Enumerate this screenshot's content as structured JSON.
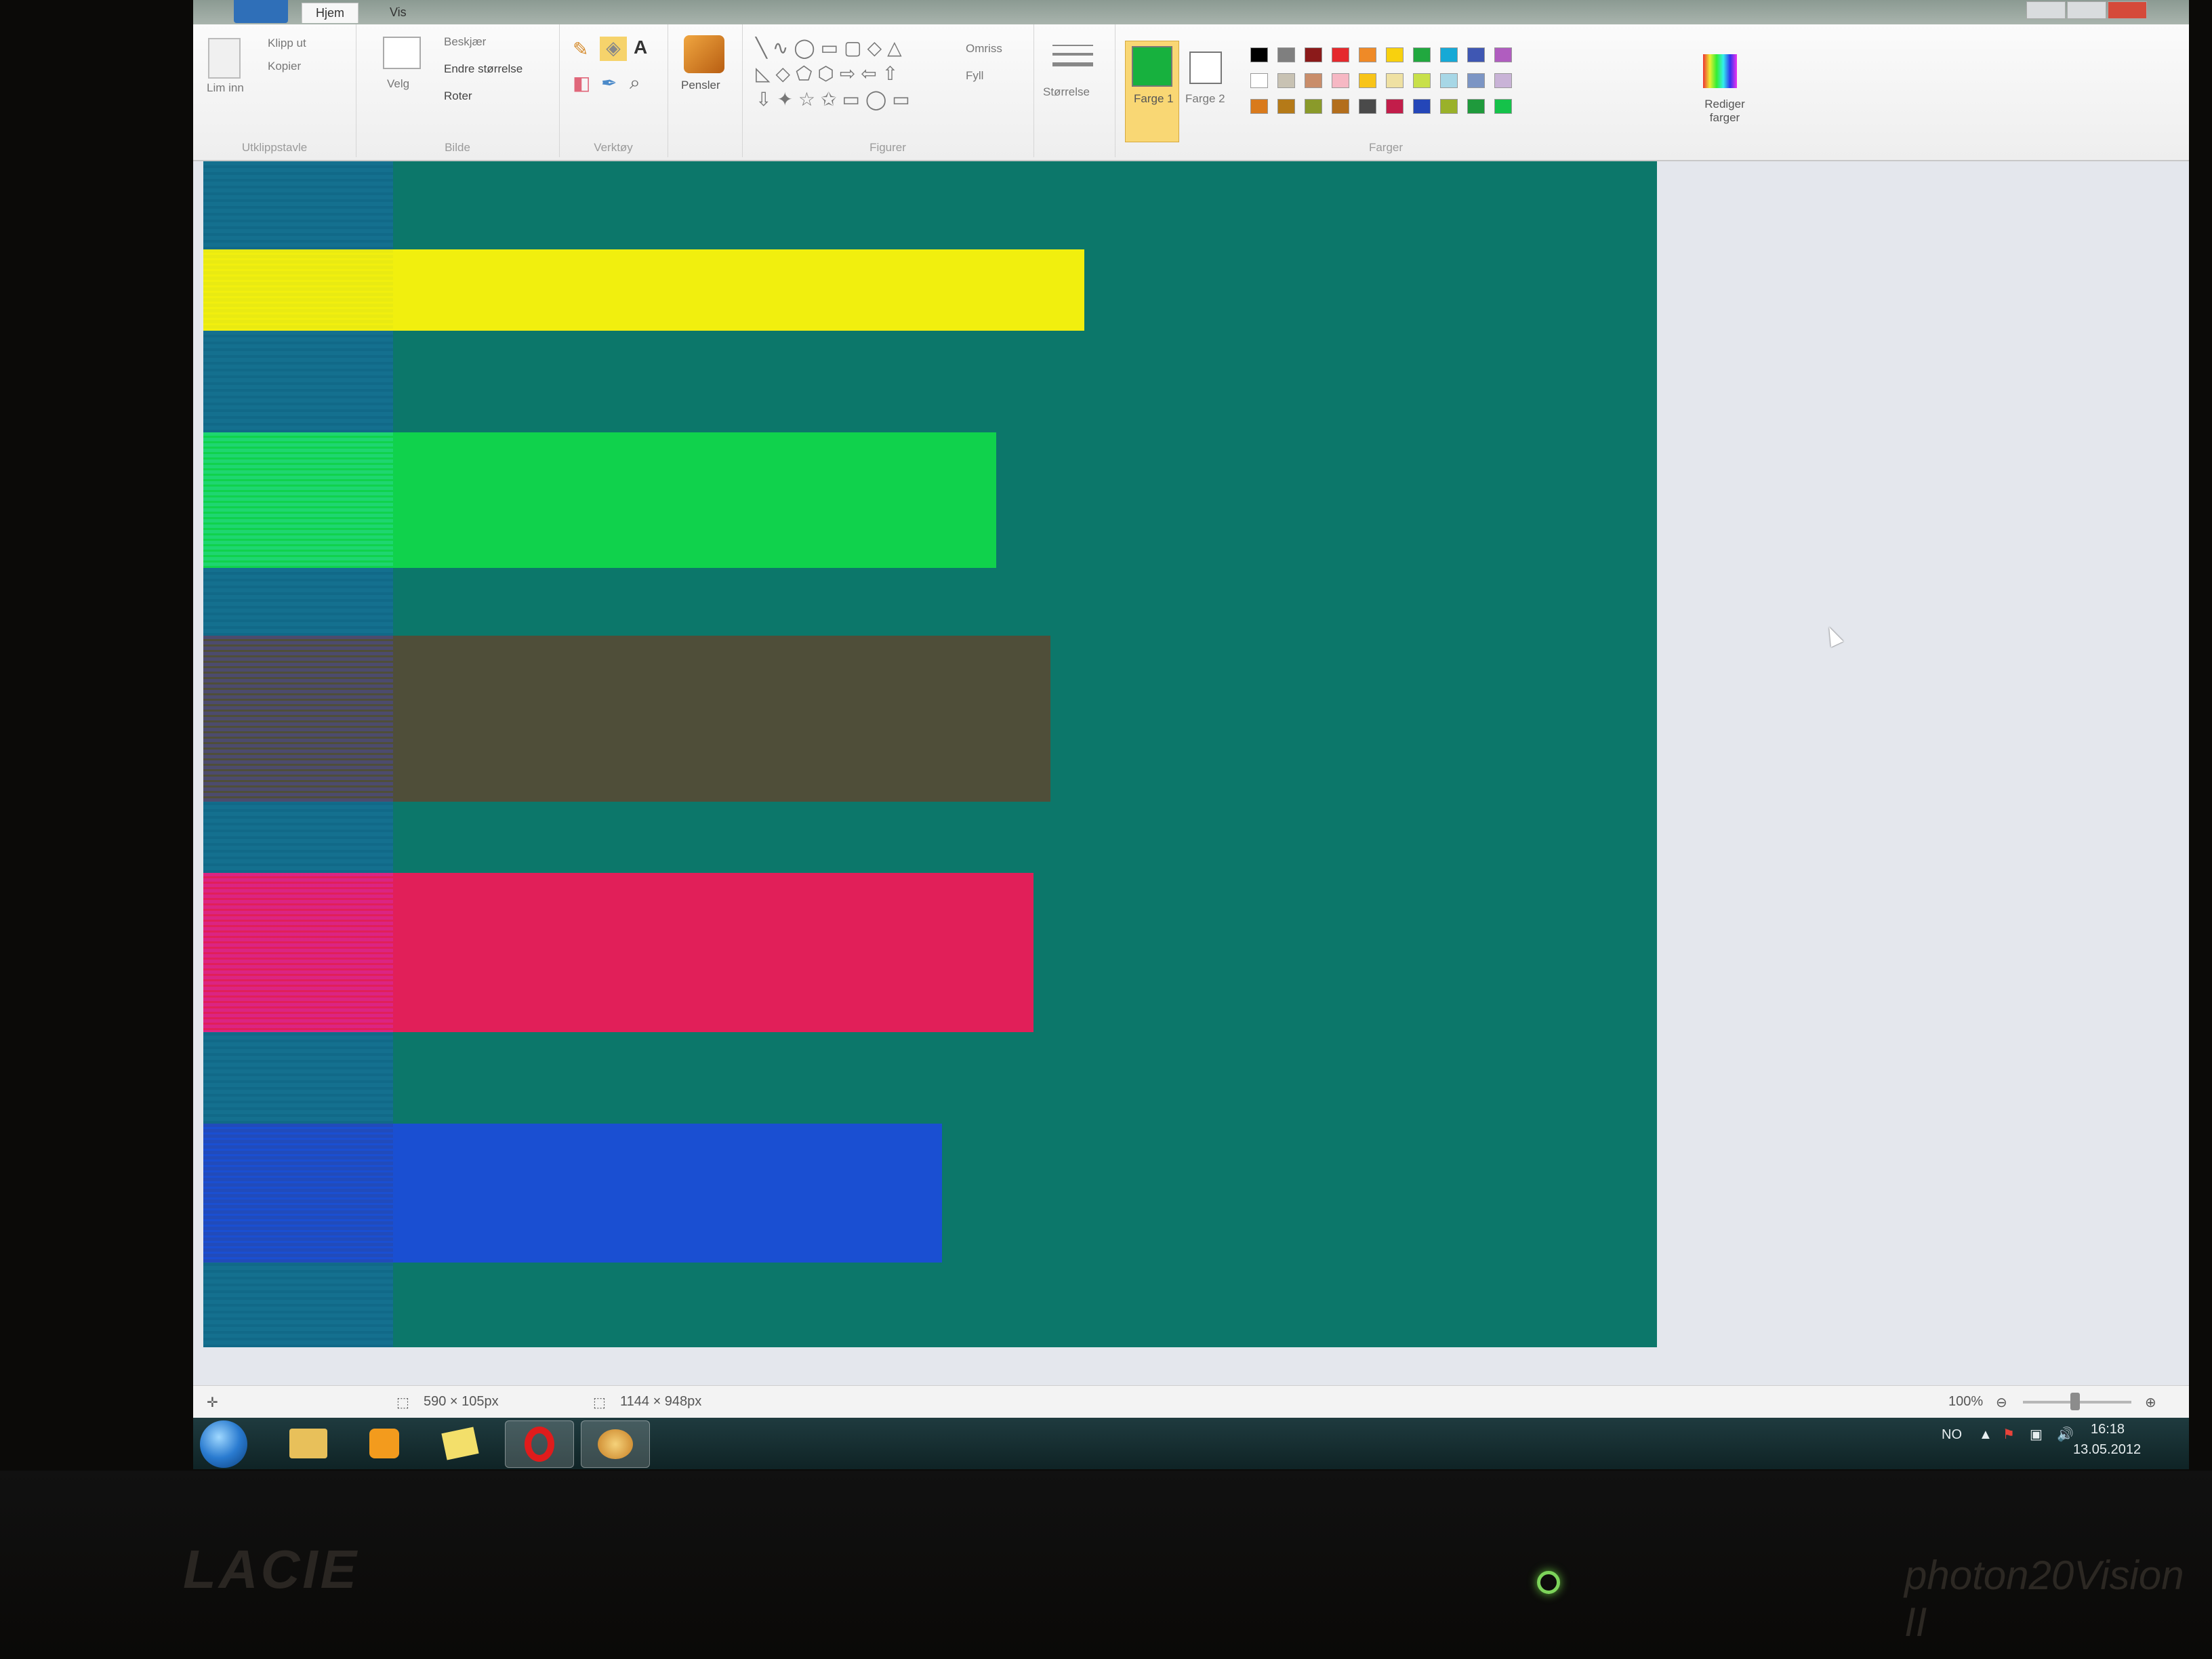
{
  "ribbon": {
    "tabs": [
      "Hjem",
      "Vis"
    ],
    "groups": {
      "clipboard": {
        "label": "Utklippstavle",
        "paste": "Lim inn",
        "cut": "Klipp ut",
        "copy": "Kopier"
      },
      "image": {
        "label": "Bilde",
        "select": "Velg",
        "crop": "Beskjær",
        "resize": "Endre størrelse",
        "rotate": "Roter"
      },
      "tools": {
        "label": "Verktøy"
      },
      "brushes": {
        "label": "Pensler"
      },
      "shapes": {
        "label": "Figurer",
        "outline": "Omriss",
        "fill": "Fyll"
      },
      "size": {
        "label": "Størrelse"
      },
      "colors": {
        "label": "Farger",
        "color1": "Farge 1",
        "color2": "Farge 2",
        "edit": "Rediger farger",
        "color1_value": "#17b13e",
        "color2_value": "#ffffff",
        "palette": [
          "#000000",
          "#7f7f7f",
          "#8b1a1a",
          "#e5292d",
          "#ef8a27",
          "#f8d10e",
          "#21a83f",
          "#16a9d6",
          "#3f57b3",
          "#b05dbf",
          "#ffffff",
          "#c8c2b3",
          "#c98d6a",
          "#f6b8c4",
          "#f8c418",
          "#efe1a3",
          "#c8e04a",
          "#a7d7e6",
          "#7c95c4",
          "#c9b3d7",
          "#d97a1c",
          "#b57a18",
          "#8a9a2a",
          "#b36e1c",
          "#4a4a4a",
          "#c21d4a",
          "#2446b8",
          "#9ab12a",
          "#1f9a3c",
          "#15c24a"
        ]
      }
    }
  },
  "canvas": {
    "background": "#0c776a",
    "bars": [
      {
        "color": "#f1ef0e",
        "left_color": "#e6e813"
      },
      {
        "color": "#10d24c",
        "left_color": "#24d77f"
      },
      {
        "color": "#4f4e39",
        "left_color": "#4b4a83"
      },
      {
        "color": "#e11f59",
        "left_color": "#d92694"
      },
      {
        "color": "#1a4fd2",
        "left_color": "#2449b1"
      }
    ]
  },
  "statusbar": {
    "selection_size": "590 × 105px",
    "image_size": "1144 × 948px",
    "zoom": "100%"
  },
  "taskbar": {
    "language": "NO",
    "time": "16:18",
    "date": "13.05.2012"
  },
  "monitor": {
    "brand_left": "LACIE",
    "brand_right": "photon20Vision II"
  }
}
